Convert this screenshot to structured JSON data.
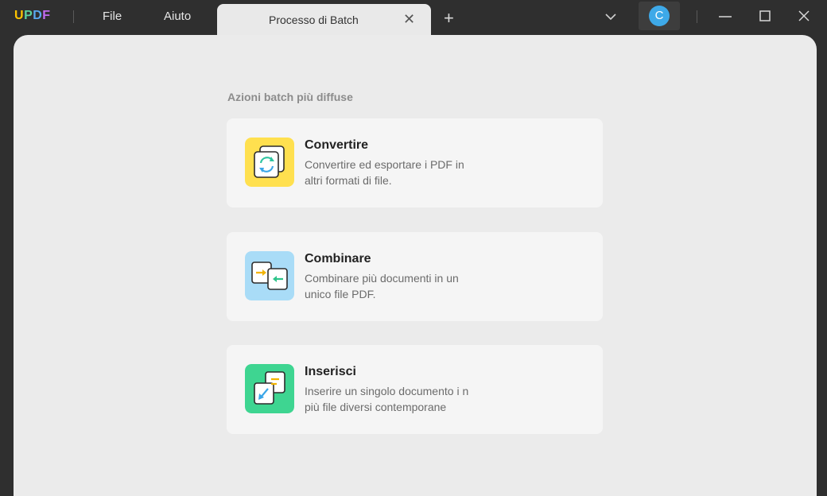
{
  "app": {
    "logo_letters": [
      "U",
      "P",
      "D",
      "F"
    ],
    "logo_colors": [
      "#ffc400",
      "#5bd1a0",
      "#5aa9f0",
      "#c26bf0"
    ],
    "avatar_initial": "C",
    "avatar_color": "#3ea9e8"
  },
  "menu": {
    "file": "File",
    "help": "Aiuto"
  },
  "tab": {
    "title": "Processo di Batch",
    "close": "✕",
    "new_tab": "+"
  },
  "section": {
    "title": "Azioni batch più diffuse"
  },
  "actions": [
    {
      "title": "Convertire",
      "description": "Convertire ed esportare i PDF in altri formati di file.",
      "icon": "convert-icon",
      "icon_bg": "#ffe04f"
    },
    {
      "title": "Combinare",
      "description": "Combinare più documenti in un unico file PDF.",
      "icon": "combine-icon",
      "icon_bg": "#a9dcf7"
    },
    {
      "title": "Inserisci",
      "description": "Inserire un singolo documento i n più file diversi contemporane",
      "icon": "insert-icon",
      "icon_bg": "#3ed591"
    }
  ]
}
